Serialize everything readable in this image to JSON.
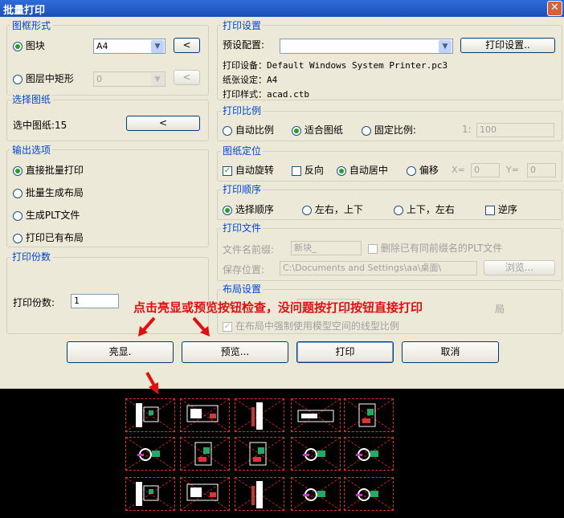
{
  "window": {
    "title": "批量打印",
    "close_icon": "close-icon"
  },
  "frame_form": {
    "title": "图框形式",
    "block_label": "图块",
    "block_value": "A4",
    "layer_rect_label": "图层中矩形",
    "layer_rect_value": "0",
    "pick_button": "<"
  },
  "select_drawings": {
    "title": "选择图纸",
    "selected_label": "选中图纸:15",
    "pick_button": "<"
  },
  "output_options": {
    "title": "输出选项",
    "items": [
      "直接批量打印",
      "批量生成布局",
      "生成PLT文件",
      "打印已有布局"
    ],
    "selected": 0
  },
  "copies": {
    "title": "打印份数",
    "label": "打印份数:",
    "value": "1"
  },
  "print_settings": {
    "title": "打印设置",
    "preset_label": "预设配置:",
    "preset_value": "",
    "settings_button": "打印设置..",
    "device_line": "打印设备：Default Windows System Printer.pc3",
    "paper_line": "纸张设定：A4",
    "style_line": "打印样式：acad.ctb"
  },
  "print_scale": {
    "title": "打印比例",
    "options": [
      "自动比例",
      "适合图纸",
      "固定比例:"
    ],
    "selected": 1,
    "ratio_prefix": "1:",
    "ratio_value": "100"
  },
  "positioning": {
    "title": "图纸定位",
    "auto_rotate": "自动旋转",
    "reverse": "反向",
    "auto_center": "自动居中",
    "offset": "偏移",
    "x_label": "X=",
    "x_value": "0",
    "y_label": "Y=",
    "y_value": "0"
  },
  "print_order": {
    "title": "打印顺序",
    "options": [
      "选择顺序",
      "左右，上下",
      "上下，左右"
    ],
    "selected": 0,
    "reverse": "逆序"
  },
  "print_file": {
    "title": "打印文件",
    "prefix_label": "文件名前缀:",
    "prefix_value": "新块_",
    "delete_label": "删除已有同前缀名的PLT文件",
    "save_label": "保存位置:",
    "save_value": "C:\\Documents and Settings\\aa\\桌面\\",
    "browse_button": "浏览..."
  },
  "layout_settings": {
    "title": "布局设置",
    "tail_text": "局",
    "linetype_label": "在布局中强制使用模型空间的线型比例"
  },
  "annotation": {
    "text": "点击亮显或预览按钮检查，没问题按打印按钮直接打印"
  },
  "buttons": {
    "highlight": "亮显.",
    "preview": "预览...",
    "print": "打印",
    "cancel": "取消"
  },
  "colors": {
    "accent": "#0046d5",
    "annotation": "#e01010",
    "radio_on": "#21a121",
    "titlebar": "#1c4fb8"
  },
  "thumbnails": [
    "sheet-1",
    "sheet-2",
    "sheet-3",
    "sheet-4",
    "sheet-5",
    "sheet-6",
    "sheet-7",
    "sheet-8",
    "sheet-9",
    "sheet-10",
    "sheet-11",
    "sheet-12",
    "sheet-13",
    "sheet-14",
    "sheet-15"
  ]
}
